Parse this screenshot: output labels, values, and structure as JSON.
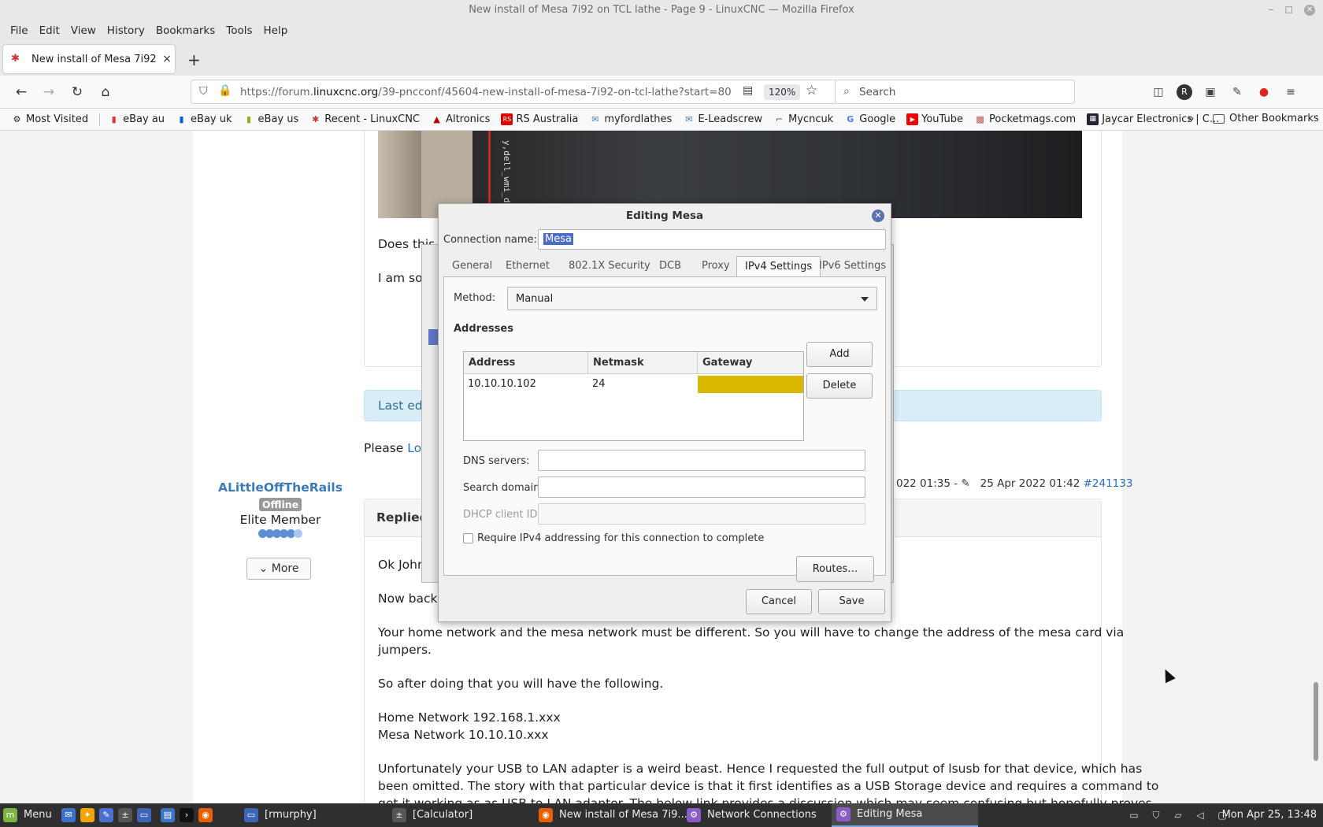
{
  "window": {
    "title": "New install of Mesa 7i92 on TCL lathe - Page 9 - LinuxCNC — Mozilla Firefox"
  },
  "menu": [
    "File",
    "Edit",
    "View",
    "History",
    "Bookmarks",
    "Tools",
    "Help"
  ],
  "tab": {
    "title": "New install of Mesa 7i92 on",
    "close": "×"
  },
  "nav": {
    "url_prefix": "https://forum.",
    "url_domain": "linuxcnc.org",
    "url_path": "/39-pncconf/45604-new-install-of-mesa-7i92-on-tcl-lathe?start=80",
    "zoom": "120%",
    "search_placeholder": "Search"
  },
  "bookmarks": [
    "Most Visited",
    "eBay au",
    "eBay uk",
    "eBay us",
    "Recent - LinuxCNC",
    "Altronics",
    "RS Australia",
    "myfordlathes",
    "E-Leadscrew",
    "Mycncuk",
    "Google",
    "YouTube",
    "Pocketmags.com",
    "Jaycar Electronics | C..."
  ],
  "bookmarks_other": "Other Bookmarks",
  "page": {
    "photo_text": "y,dell_wmi_d",
    "p1": "Does this t",
    "p2": "I am sor",
    "last_edit": "Last edi",
    "please": "Please ",
    "login": "Log",
    "author": {
      "name": "ALittleOffTheRails",
      "status": "Offline",
      "rank": "Elite Member",
      "more": "More"
    },
    "meta_left": "022 01:35 - ",
    "meta_date": "25 Apr 2022 01:42",
    "meta_id": "#241133",
    "replied": "Replied",
    "lines": [
      "Ok John",
      "Now back t",
      "Your home network and the mesa network must be different. So you will have to change the address of the mesa card via",
      "jumpers.",
      "So after doing that you will have the following.",
      "Home Network 192.168.1.xxx",
      "Mesa Network 10.10.10.xxx",
      "Unfortunately your USB to LAN adapter is a weird beast. Hence I requested the full output of lsusb for that device, which has",
      "been omitted. The story with that particular device is that it first identifies as a USB Storage device and requires a command to",
      "get it working as as USB to LAN adaptor. The below link provides a discussion which may seem confusing but hopefully proves"
    ]
  },
  "dialog": {
    "title": "Editing Mesa",
    "connection_name_label": "Connection name:",
    "connection_name": "Mesa",
    "tabs": [
      "General",
      "Ethernet",
      "802.1X Security",
      "DCB",
      "Proxy",
      "IPv4 Settings",
      "IPv6 Settings"
    ],
    "method_label": "Method:",
    "method": "Manual",
    "addresses_label": "Addresses",
    "columns": [
      "Address",
      "Netmask",
      "Gateway"
    ],
    "row": {
      "address": "10.10.10.102",
      "netmask": "24",
      "gateway": ""
    },
    "add": "Add",
    "delete": "Delete",
    "dns_label": "DNS servers:",
    "search_domains_label": "Search domains:",
    "dhcp_label": "DHCP client ID:",
    "require_label": "Require IPv4 addressing for this connection to complete",
    "routes": "Routes…",
    "cancel": "Cancel",
    "save": "Save"
  },
  "taskbar": {
    "menu": "Menu",
    "items": [
      "[rmurphy]",
      "[Calculator]",
      "New install of Mesa 7i9...",
      "Network Connections",
      "Editing Mesa"
    ],
    "clock": "Mon Apr 25, 13:48"
  }
}
